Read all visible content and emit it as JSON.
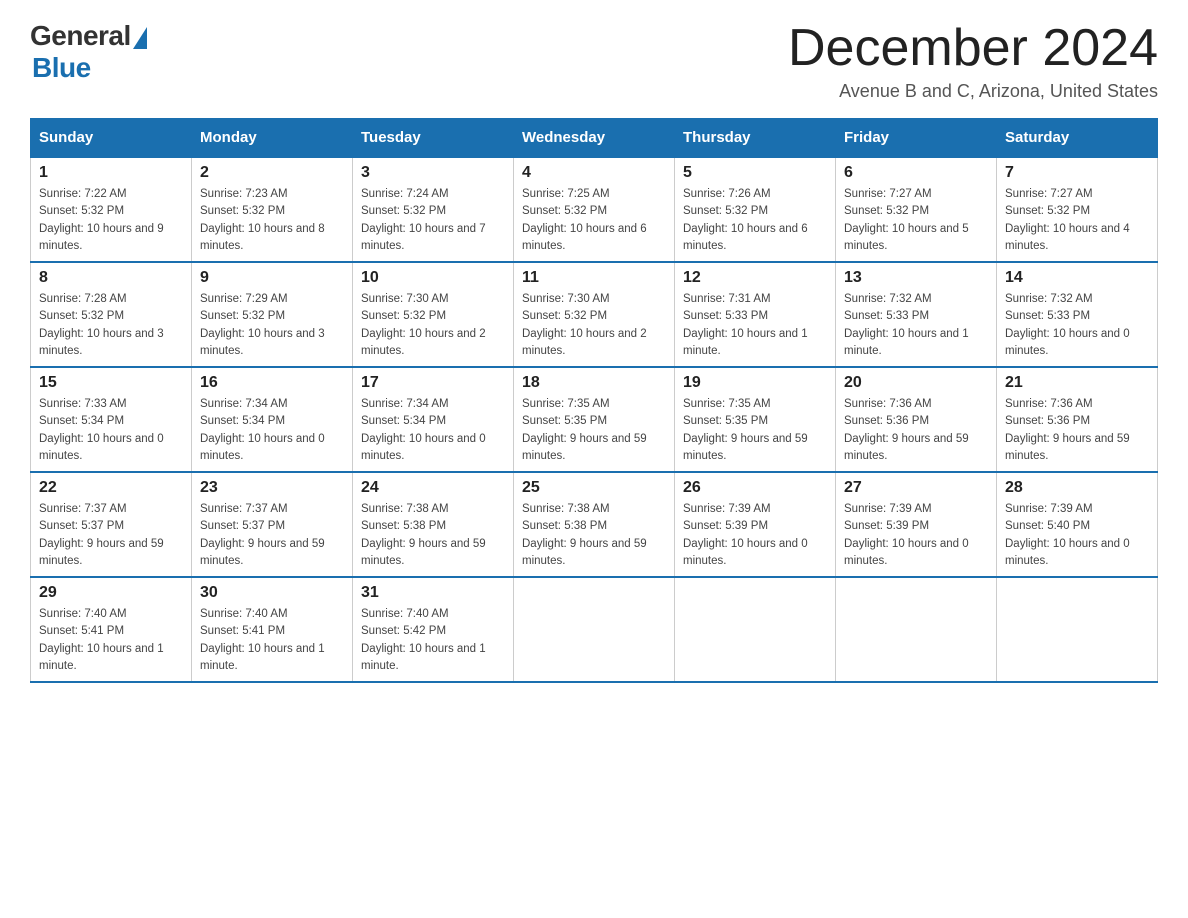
{
  "header": {
    "logo_general": "General",
    "logo_blue": "Blue",
    "month_title": "December 2024",
    "subtitle": "Avenue B and C, Arizona, United States"
  },
  "weekdays": [
    "Sunday",
    "Monday",
    "Tuesday",
    "Wednesday",
    "Thursday",
    "Friday",
    "Saturday"
  ],
  "weeks": [
    [
      {
        "day": "1",
        "sunrise": "7:22 AM",
        "sunset": "5:32 PM",
        "daylight": "10 hours and 9 minutes."
      },
      {
        "day": "2",
        "sunrise": "7:23 AM",
        "sunset": "5:32 PM",
        "daylight": "10 hours and 8 minutes."
      },
      {
        "day": "3",
        "sunrise": "7:24 AM",
        "sunset": "5:32 PM",
        "daylight": "10 hours and 7 minutes."
      },
      {
        "day": "4",
        "sunrise": "7:25 AM",
        "sunset": "5:32 PM",
        "daylight": "10 hours and 6 minutes."
      },
      {
        "day": "5",
        "sunrise": "7:26 AM",
        "sunset": "5:32 PM",
        "daylight": "10 hours and 6 minutes."
      },
      {
        "day": "6",
        "sunrise": "7:27 AM",
        "sunset": "5:32 PM",
        "daylight": "10 hours and 5 minutes."
      },
      {
        "day": "7",
        "sunrise": "7:27 AM",
        "sunset": "5:32 PM",
        "daylight": "10 hours and 4 minutes."
      }
    ],
    [
      {
        "day": "8",
        "sunrise": "7:28 AM",
        "sunset": "5:32 PM",
        "daylight": "10 hours and 3 minutes."
      },
      {
        "day": "9",
        "sunrise": "7:29 AM",
        "sunset": "5:32 PM",
        "daylight": "10 hours and 3 minutes."
      },
      {
        "day": "10",
        "sunrise": "7:30 AM",
        "sunset": "5:32 PM",
        "daylight": "10 hours and 2 minutes."
      },
      {
        "day": "11",
        "sunrise": "7:30 AM",
        "sunset": "5:32 PM",
        "daylight": "10 hours and 2 minutes."
      },
      {
        "day": "12",
        "sunrise": "7:31 AM",
        "sunset": "5:33 PM",
        "daylight": "10 hours and 1 minute."
      },
      {
        "day": "13",
        "sunrise": "7:32 AM",
        "sunset": "5:33 PM",
        "daylight": "10 hours and 1 minute."
      },
      {
        "day": "14",
        "sunrise": "7:32 AM",
        "sunset": "5:33 PM",
        "daylight": "10 hours and 0 minutes."
      }
    ],
    [
      {
        "day": "15",
        "sunrise": "7:33 AM",
        "sunset": "5:34 PM",
        "daylight": "10 hours and 0 minutes."
      },
      {
        "day": "16",
        "sunrise": "7:34 AM",
        "sunset": "5:34 PM",
        "daylight": "10 hours and 0 minutes."
      },
      {
        "day": "17",
        "sunrise": "7:34 AM",
        "sunset": "5:34 PM",
        "daylight": "10 hours and 0 minutes."
      },
      {
        "day": "18",
        "sunrise": "7:35 AM",
        "sunset": "5:35 PM",
        "daylight": "9 hours and 59 minutes."
      },
      {
        "day": "19",
        "sunrise": "7:35 AM",
        "sunset": "5:35 PM",
        "daylight": "9 hours and 59 minutes."
      },
      {
        "day": "20",
        "sunrise": "7:36 AM",
        "sunset": "5:36 PM",
        "daylight": "9 hours and 59 minutes."
      },
      {
        "day": "21",
        "sunrise": "7:36 AM",
        "sunset": "5:36 PM",
        "daylight": "9 hours and 59 minutes."
      }
    ],
    [
      {
        "day": "22",
        "sunrise": "7:37 AM",
        "sunset": "5:37 PM",
        "daylight": "9 hours and 59 minutes."
      },
      {
        "day": "23",
        "sunrise": "7:37 AM",
        "sunset": "5:37 PM",
        "daylight": "9 hours and 59 minutes."
      },
      {
        "day": "24",
        "sunrise": "7:38 AM",
        "sunset": "5:38 PM",
        "daylight": "9 hours and 59 minutes."
      },
      {
        "day": "25",
        "sunrise": "7:38 AM",
        "sunset": "5:38 PM",
        "daylight": "9 hours and 59 minutes."
      },
      {
        "day": "26",
        "sunrise": "7:39 AM",
        "sunset": "5:39 PM",
        "daylight": "10 hours and 0 minutes."
      },
      {
        "day": "27",
        "sunrise": "7:39 AM",
        "sunset": "5:39 PM",
        "daylight": "10 hours and 0 minutes."
      },
      {
        "day": "28",
        "sunrise": "7:39 AM",
        "sunset": "5:40 PM",
        "daylight": "10 hours and 0 minutes."
      }
    ],
    [
      {
        "day": "29",
        "sunrise": "7:40 AM",
        "sunset": "5:41 PM",
        "daylight": "10 hours and 1 minute."
      },
      {
        "day": "30",
        "sunrise": "7:40 AM",
        "sunset": "5:41 PM",
        "daylight": "10 hours and 1 minute."
      },
      {
        "day": "31",
        "sunrise": "7:40 AM",
        "sunset": "5:42 PM",
        "daylight": "10 hours and 1 minute."
      },
      null,
      null,
      null,
      null
    ]
  ]
}
